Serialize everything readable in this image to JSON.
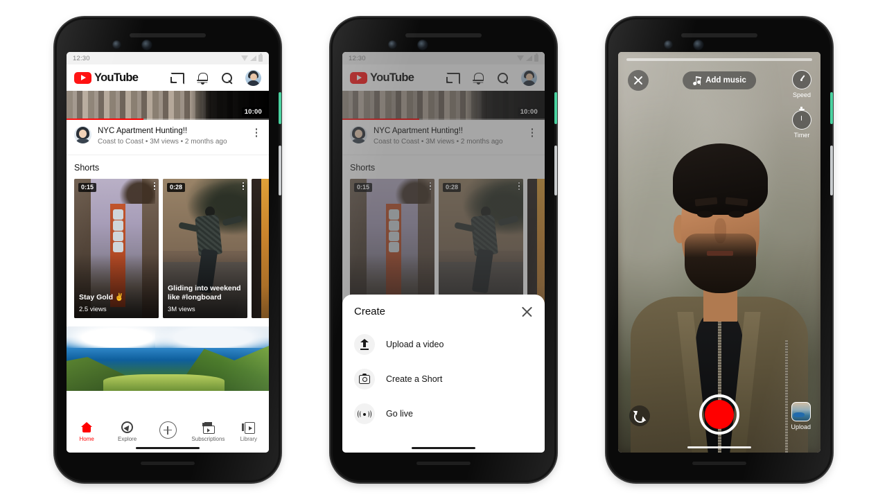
{
  "status_bar": {
    "time": "12:30",
    "icons": [
      "wifi-icon",
      "signal-icon",
      "battery-icon"
    ]
  },
  "brand": {
    "name": "YouTube",
    "accent": "#ff0000",
    "play_icon": "youtube-play-icon"
  },
  "header": {
    "actions": [
      {
        "name": "cast-icon",
        "label": "Cast"
      },
      {
        "name": "notifications-bell-icon",
        "label": "Notifications"
      },
      {
        "name": "search-icon",
        "label": "Search"
      },
      {
        "name": "account-avatar",
        "label": "Account"
      }
    ]
  },
  "feed": {
    "video": {
      "duration": "10:00",
      "title": "NYC Apartment Hunting!!",
      "meta": "Coast to Coast • 3M views • 2 months ago",
      "channel": "Coast to Coast",
      "views": "3M views",
      "age": "2 months ago",
      "menu_icon": "kebab-menu-icon"
    },
    "shorts": {
      "header": "Shorts",
      "items": [
        {
          "duration": "0:15",
          "title": "Stay Gold ✌️",
          "views": "2.5 views"
        },
        {
          "duration": "0:28",
          "title": "Gliding into weekend like #longboard",
          "views": "3M views"
        },
        {
          "duration": "",
          "title": "",
          "views": ""
        }
      ]
    }
  },
  "bottom_nav": {
    "items": [
      {
        "label": "Home",
        "icon": "home-icon",
        "active": true
      },
      {
        "label": "Explore",
        "icon": "compass-icon",
        "active": false
      },
      {
        "label": "",
        "icon": "plus-create-icon",
        "active": false
      },
      {
        "label": "Subscriptions",
        "icon": "subscriptions-icon",
        "active": false
      },
      {
        "label": "Library",
        "icon": "library-icon",
        "active": false
      }
    ]
  },
  "create_sheet": {
    "title": "Create",
    "close_icon": "close-icon",
    "items": [
      {
        "label": "Upload a video",
        "icon": "upload-icon"
      },
      {
        "label": "Create a Short",
        "icon": "camera-icon"
      },
      {
        "label": "Go live",
        "icon": "live-broadcast-icon"
      }
    ]
  },
  "camera": {
    "close_icon": "close-icon",
    "add_music": {
      "label": "Add music",
      "icon": "music-note-icon"
    },
    "tools": [
      {
        "label": "Speed",
        "icon": "speedometer-icon"
      },
      {
        "label": "Timer",
        "icon": "stopwatch-icon"
      }
    ],
    "flip_icon": "flip-camera-icon",
    "record_icon": "record-button",
    "upload": {
      "label": "Upload",
      "icon": "upload-thumbnail"
    }
  }
}
